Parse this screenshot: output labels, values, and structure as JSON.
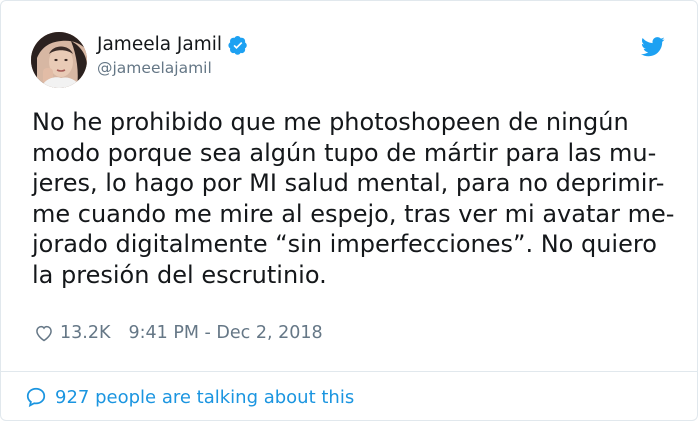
{
  "tweet": {
    "author_name": "Jameela Jamil",
    "author_handle": "@jameelajamil",
    "text": "No he prohibido que me photoshopeen de ningún\nmodo porque sea algún tupo de mártir para las mu-\njeres, lo hago por MI salud mental, para no deprimir-\nme cuando me mire al espejo, tras ver mi avatar me-\njorado digitalmente “sin imperfecciones”. No quiero\nla presión del escrutinio.",
    "likes": "13.2K",
    "timestamp": "9:41 PM - Dec 2, 2018"
  },
  "footer": {
    "talking": "927 people are talking about this"
  },
  "icons": {
    "verified": "verified-badge-icon",
    "bird": "twitter-bird-icon",
    "heart": "heart-icon",
    "comment": "comment-bubble-icon"
  },
  "colors": {
    "accent": "#1da1f2",
    "link": "#1b95e0",
    "muted": "#657786",
    "text": "#14171a"
  }
}
